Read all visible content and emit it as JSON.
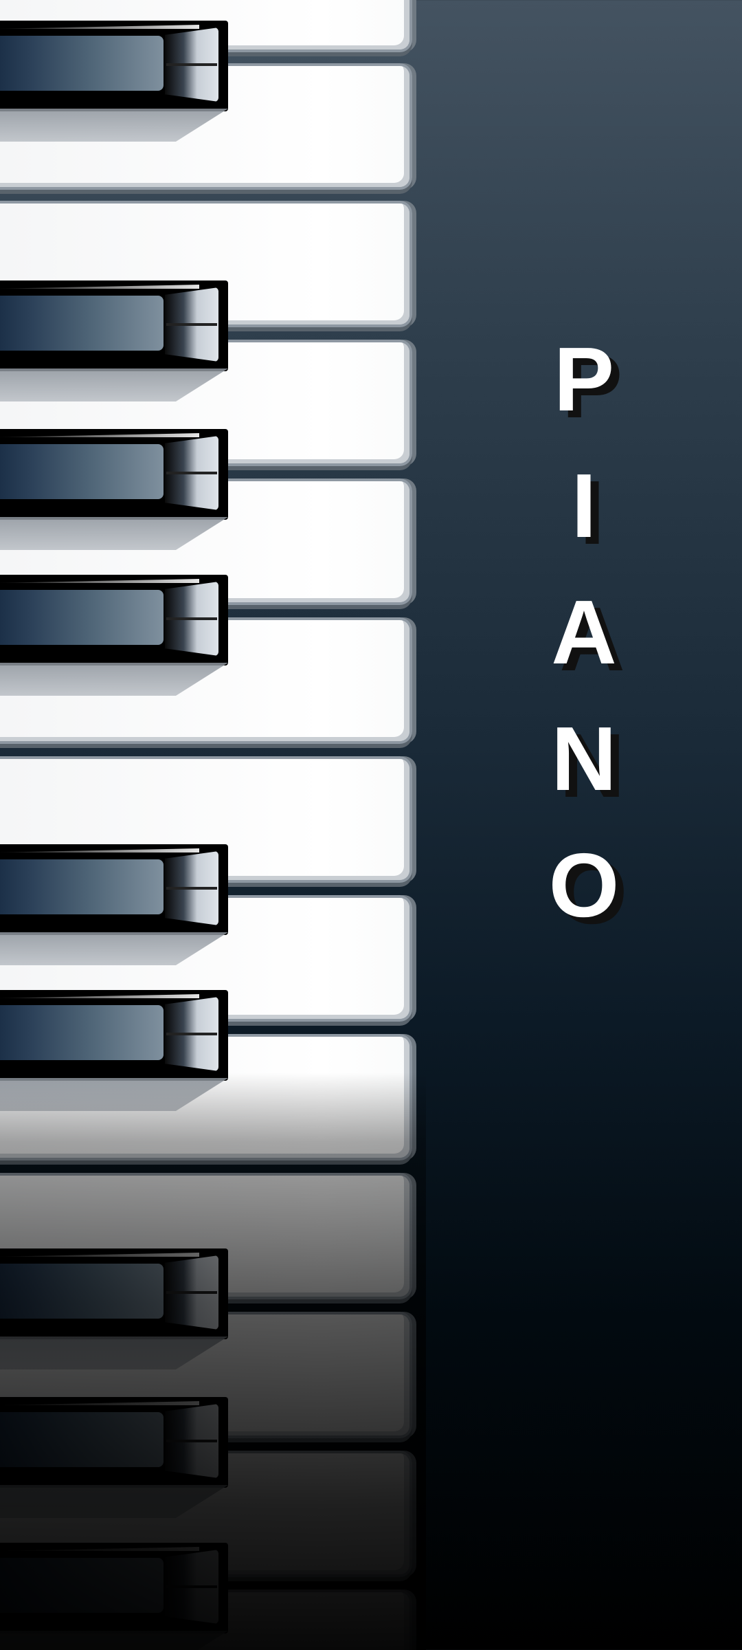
{
  "title": {
    "letters": [
      "P",
      "I",
      "A",
      "N",
      "O"
    ]
  },
  "keyboard": {
    "white_key_count": 12,
    "black_key_count": 9
  },
  "colors": {
    "background_top": "#445361",
    "background_bottom": "#000000",
    "white_key": "#ffffff",
    "black_key": "#000000",
    "title_text": "#ffffff",
    "title_shadow": "#111111"
  }
}
